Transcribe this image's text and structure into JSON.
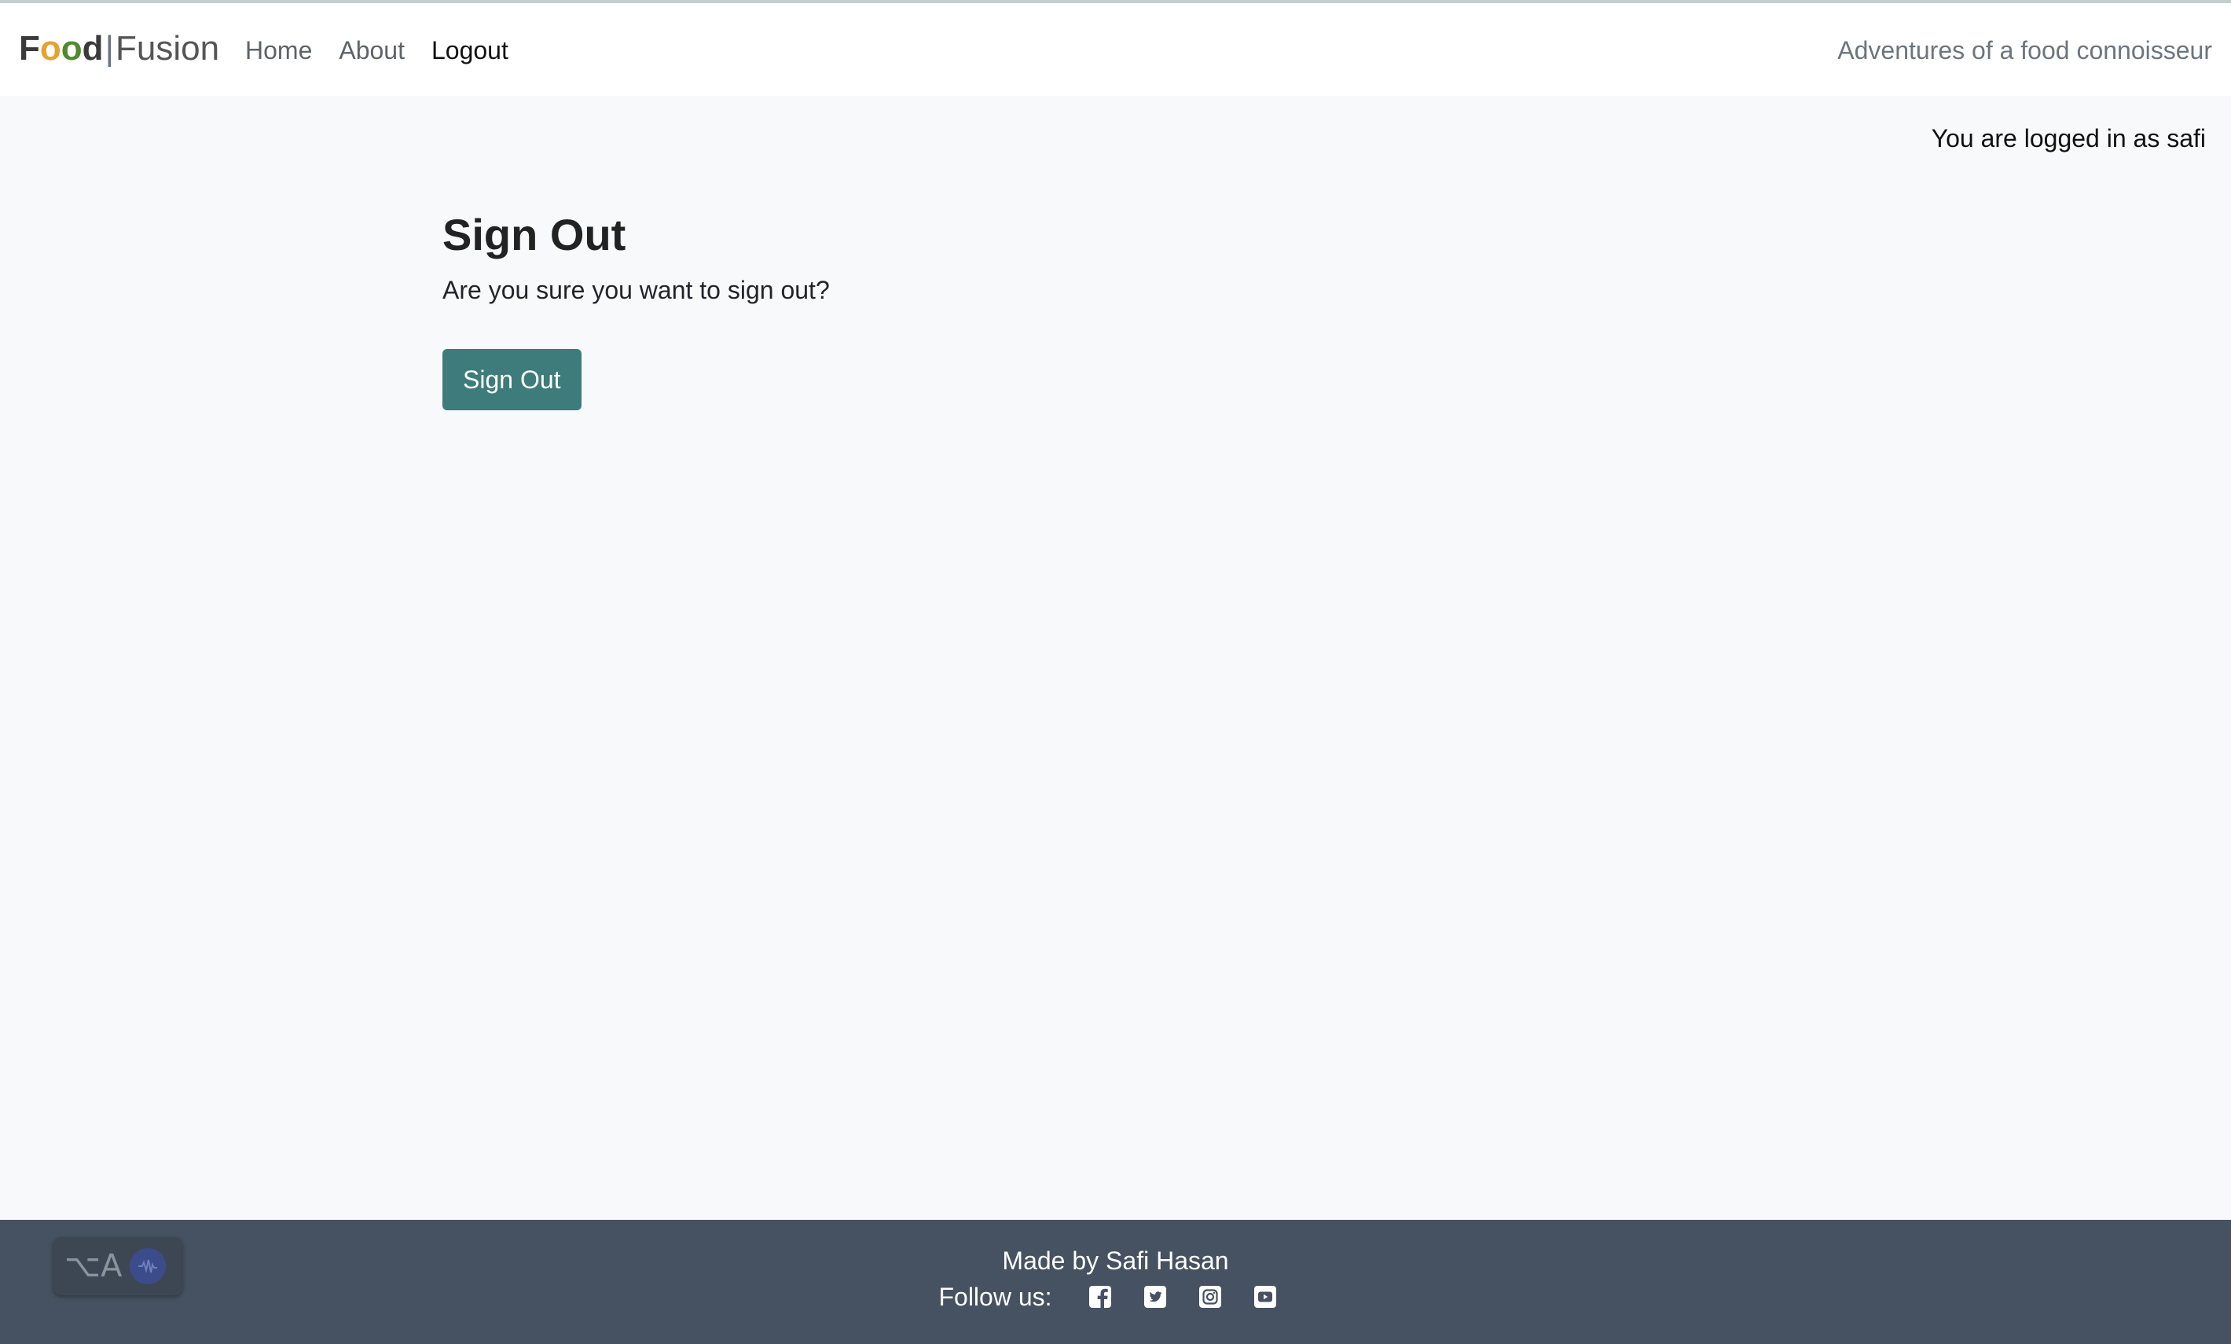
{
  "brand": {
    "f": "F",
    "o1": "o",
    "o2": "o",
    "d": "d",
    "separator": "|",
    "fusion": "Fusion"
  },
  "nav": {
    "items": [
      {
        "label": "Home"
      },
      {
        "label": "About"
      },
      {
        "label": "Logout",
        "active": true
      }
    ]
  },
  "tagline": "Adventures of a food connoisseur",
  "status": {
    "logged_in": "You are logged in as safi"
  },
  "main": {
    "title": "Sign Out",
    "question": "Are you sure you want to sign out?",
    "button_label": "Sign Out"
  },
  "footer": {
    "made_by": "Made by Safi Hasan",
    "follow_label": "Follow us:",
    "social_icons": [
      "facebook-icon",
      "twitter-icon",
      "instagram-icon",
      "youtube-icon"
    ],
    "widget": {
      "keys": "⌥A",
      "icon": "audio-wave-icon"
    }
  },
  "colors": {
    "accent_button": "#3e7b7b",
    "footer_bg": "#465261",
    "page_bg": "#f8f9fa",
    "brand_orange": "#e7a12d",
    "brand_green": "#4f8a2e"
  }
}
